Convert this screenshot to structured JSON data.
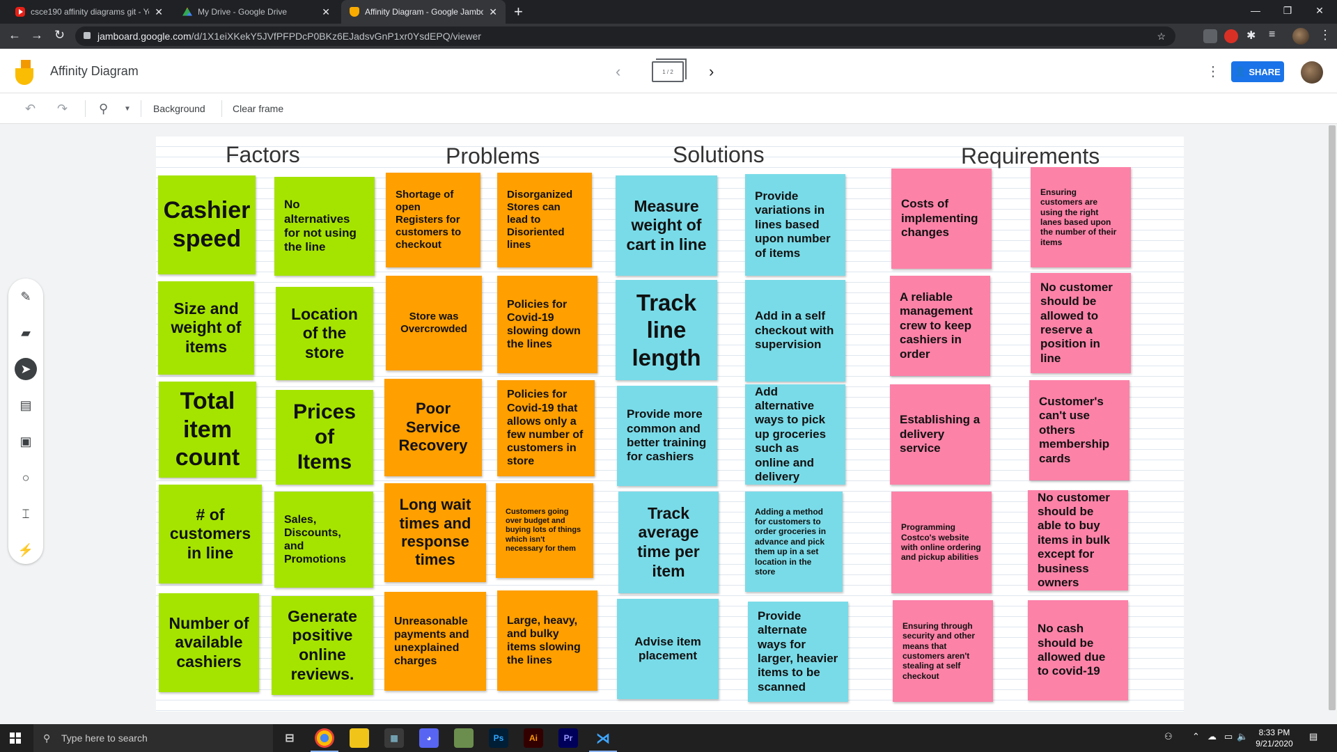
{
  "browser": {
    "tabs": [
      {
        "title": "csce190 affinity diagrams git - Yo",
        "icon": "youtube-icon",
        "active": false
      },
      {
        "title": "My Drive - Google Drive",
        "icon": "google-drive-icon",
        "active": false
      },
      {
        "title": "Affinity Diagram - Google Jambo",
        "icon": "jamboard-icon",
        "active": true
      }
    ],
    "url_host": "jamboard.google.com",
    "url_path": "/d/1X1eiXKekY5JVfPFPDcP0BKz6EJadsvGnP1xr0YsdEPQ/viewer"
  },
  "app": {
    "title": "Affinity Diagram",
    "frame_indicator": "1 / 2",
    "share_label": "SHARE"
  },
  "toolbar": {
    "background_label": "Background",
    "clear_frame_label": "Clear frame"
  },
  "board": {
    "headings": {
      "factors": "Factors",
      "problems": "Problems",
      "solutions": "Solutions",
      "requirements": "Requirements"
    },
    "factors": [
      "Cashier speed",
      "No alternatives for not using the line",
      "Size and weight of items",
      "Location of the store",
      "Total item count",
      "Prices of Items",
      "# of customers in line",
      "Sales, Discounts, and Promotions",
      "Number of available cashiers",
      "Generate positive online reviews."
    ],
    "problems": [
      "Shortage of open Registers for customers to checkout",
      "Disorganized Stores can lead to Disoriented lines",
      "Store was Overcrowded",
      "Policies for Covid-19 slowing down the lines",
      "Poor Service Recovery",
      "Policies for Covid-19 that allows only a few number of customers in store",
      "Long wait times and response times",
      "Customers going over budget and buying lots of things which isn't necessary for them",
      "Unreasonable payments and unexplained charges",
      "Large, heavy, and bulky items slowing the lines"
    ],
    "solutions": [
      "Measure weight of cart in line",
      "Provide variations in lines based upon number of items",
      "Track line length",
      "Add in a self checkout with supervision",
      "Provide more common and better training for cashiers",
      "Add alternative ways to pick up groceries such as online and delivery",
      "Track average time per item",
      "Adding a method for customers to order groceries in advance and pick them up in a set location in the store",
      "Advise item placement",
      "Provide alternate ways for larger, heavier items to be scanned"
    ],
    "requirements": [
      "Costs of implementing changes",
      "Ensuring customers are using the right lanes based upon the number of their items",
      "A reliable management crew to keep cashiers in order",
      "No customer should be allowed to reserve a position in line",
      "Establishing a delivery service",
      "Customer's can't use others membership cards",
      "Programming Costco's website with online ordering and pickup abilities",
      "No customer should be able to buy items in bulk except for business owners",
      "Ensuring through security and other means that customers aren't stealing at self checkout",
      "No cash should be allowed due to covid-19"
    ]
  },
  "colors": {
    "factors_note": "#a5e400",
    "problems_note": "#ff9f00",
    "solutions_note": "#79dbe8",
    "requirements_note": "#fc82a8",
    "share_button": "#1a73e8"
  },
  "taskbar": {
    "search_placeholder": "Type here to search",
    "time": "8:33 PM",
    "date": "9/21/2020"
  }
}
